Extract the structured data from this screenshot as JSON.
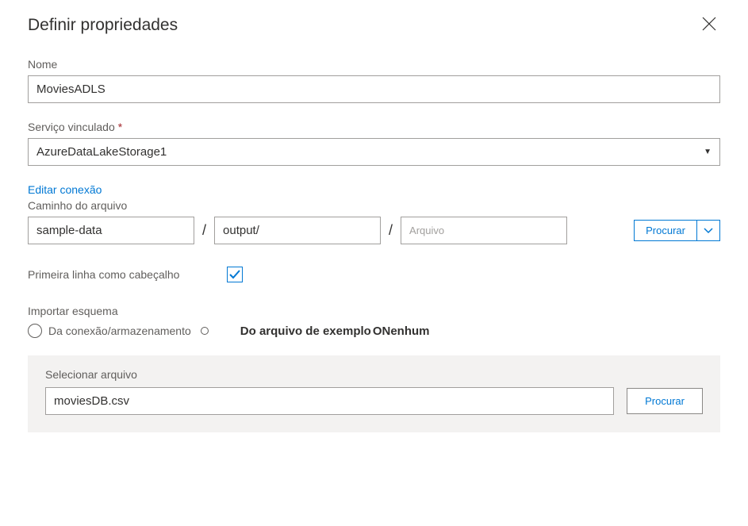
{
  "title": "Definir propriedades",
  "nameField": {
    "label": "Nome",
    "value": "MoviesADLS"
  },
  "linkedService": {
    "label": "Serviço vinculado",
    "value": "AzureDataLakeStorage1"
  },
  "editConnection": "Editar conexão",
  "filePath": {
    "label": "Caminho do arquivo",
    "container": "sample-data",
    "directory": "output/",
    "filePlaceholder": "Arquivo",
    "browse": "Procurar"
  },
  "firstRowHeader": {
    "label": "Primeira linha como cabeçalho"
  },
  "importSchema": {
    "label": "Importar esquema",
    "options": {
      "fromConnection": "Da conexão/armazenamento",
      "fromSample": "Do arquivo de exemplo",
      "none": "Nenhum"
    }
  },
  "selectFile": {
    "label": "Selecionar arquivo",
    "value": "moviesDB.csv",
    "browse": "Procurar"
  }
}
